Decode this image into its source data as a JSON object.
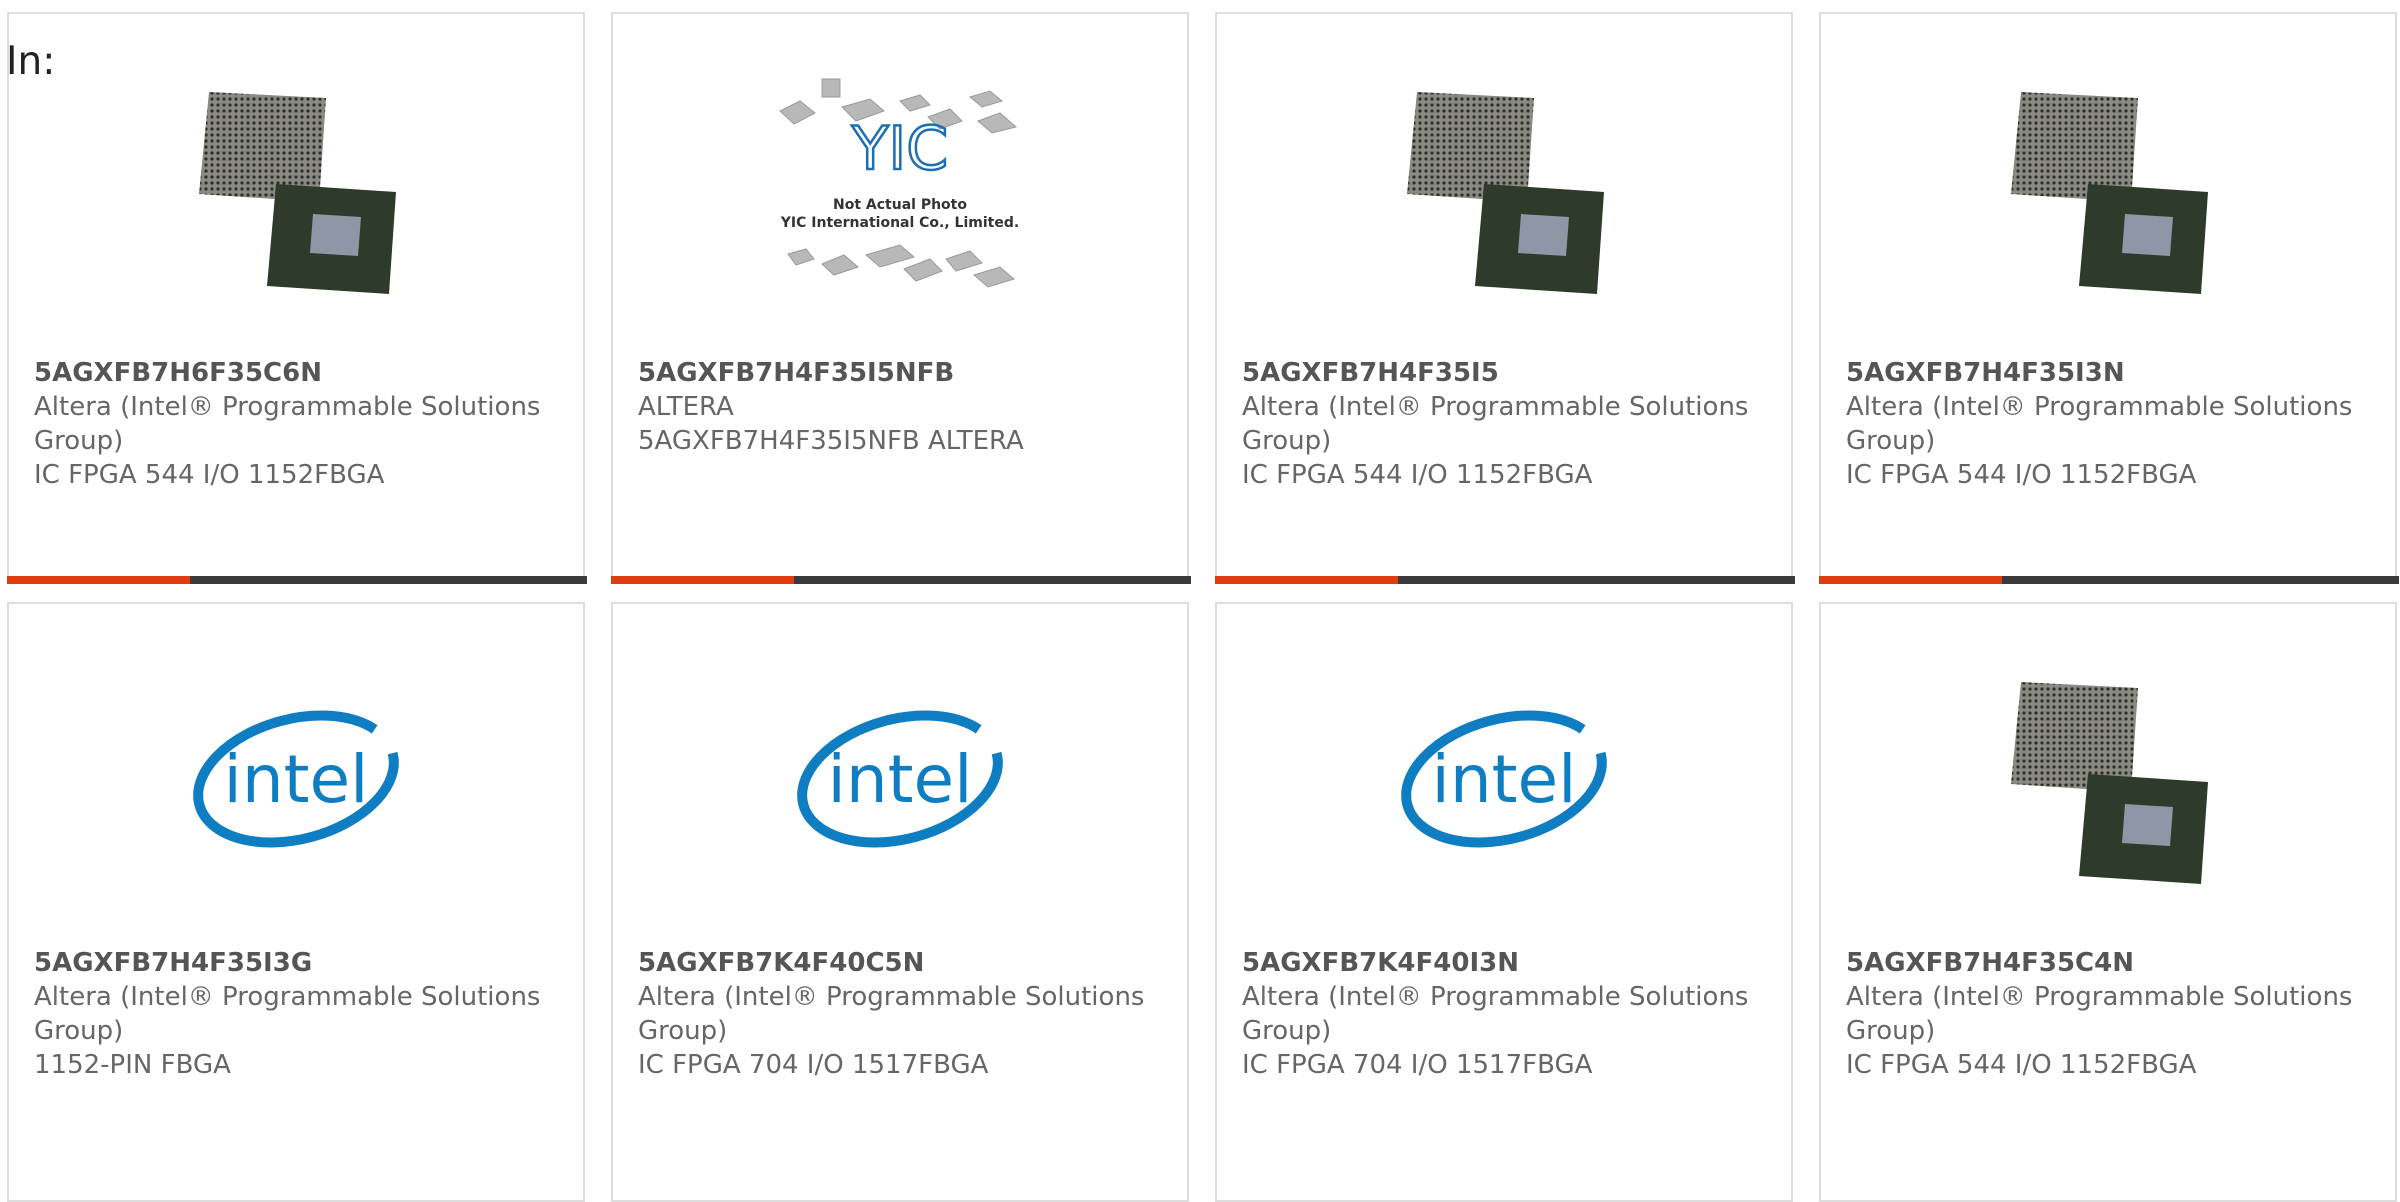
{
  "header": {
    "in_label": "In:"
  },
  "colors": {
    "accent": "#e03c12",
    "bar": "#3a3a3a",
    "intel_blue": "#0f7dc2"
  },
  "products": [
    {
      "part_number": "5AGXFB7H6F35C6N",
      "manufacturer": "Altera (Intel® Programmable Solutions Group)",
      "description": "IC FPGA 544 I/O 1152FBGA",
      "image": "bga-chip-photo"
    },
    {
      "part_number": "5AGXFB7H4F35I5NFB",
      "manufacturer": "ALTERA",
      "description": "5AGXFB7H4F35I5NFB ALTERA",
      "image": "yic-placeholder",
      "image_caption_line1": "Not Actual Photo",
      "image_caption_line2": "YIC International Co., Limited.",
      "image_logo": "YIC"
    },
    {
      "part_number": "5AGXFB7H4F35I5",
      "manufacturer": "Altera (Intel® Programmable Solutions Group)",
      "description": "IC FPGA 544 I/O 1152FBGA",
      "image": "bga-chip-photo"
    },
    {
      "part_number": "5AGXFB7H4F35I3N",
      "manufacturer": "Altera (Intel® Programmable Solutions Group)",
      "description": "IC FPGA 544 I/O 1152FBGA",
      "image": "bga-chip-photo"
    },
    {
      "part_number": "5AGXFB7H4F35I3G",
      "manufacturer": "Altera (Intel® Programmable Solutions Group)",
      "description": "1152-PIN FBGA",
      "image": "intel-logo",
      "image_logo": "intel"
    },
    {
      "part_number": "5AGXFB7K4F40C5N",
      "manufacturer": "Altera (Intel® Programmable Solutions Group)",
      "description": "IC FPGA 704 I/O 1517FBGA",
      "image": "intel-logo",
      "image_logo": "intel"
    },
    {
      "part_number": "5AGXFB7K4F40I3N",
      "manufacturer": "Altera (Intel® Programmable Solutions Group)",
      "description": "IC FPGA 704 I/O 1517FBGA",
      "image": "intel-logo",
      "image_logo": "intel"
    },
    {
      "part_number": "5AGXFB7H4F35C4N",
      "manufacturer": "Altera (Intel® Programmable Solutions Group)",
      "description": "IC FPGA 544 I/O 1152FBGA",
      "image": "bga-chip-photo"
    }
  ]
}
